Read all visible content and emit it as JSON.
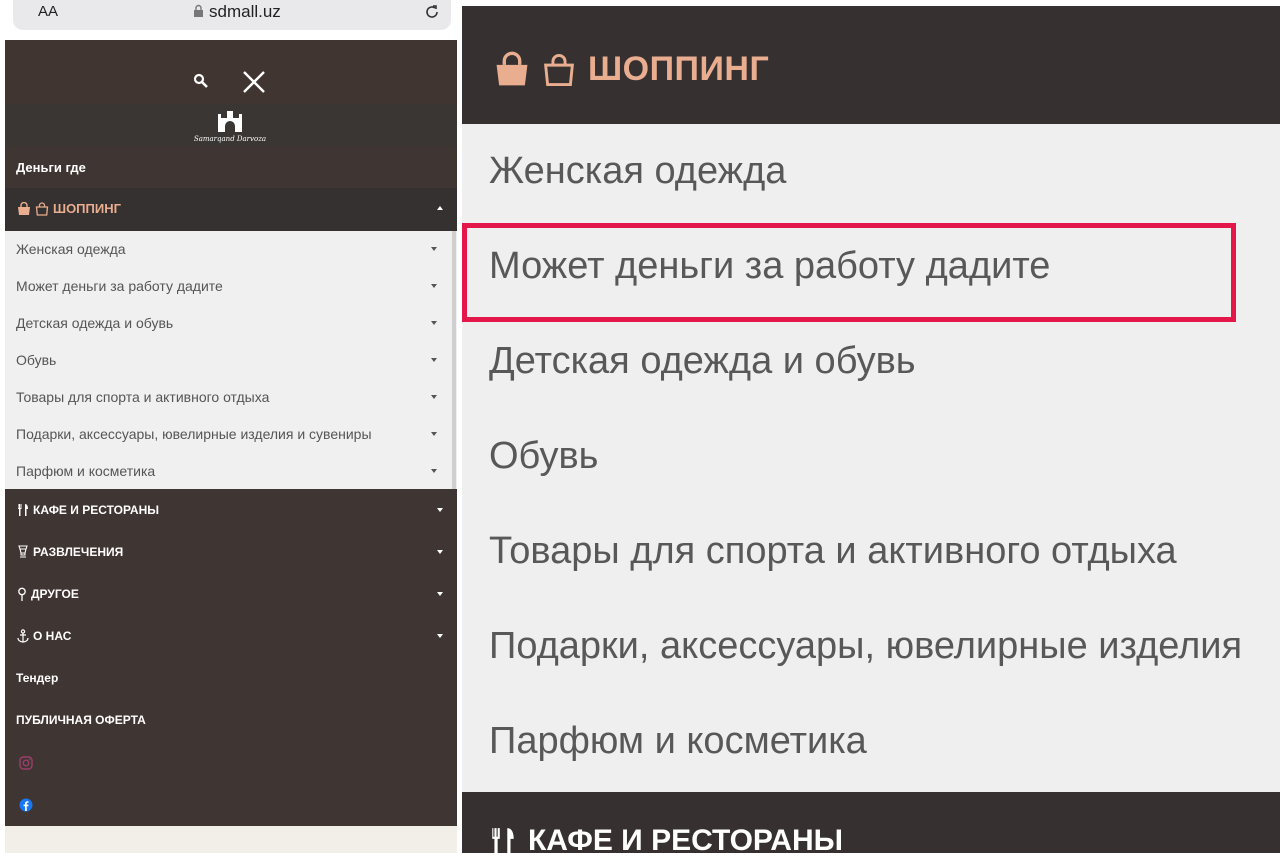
{
  "browser": {
    "text_size_label": "AA",
    "url": "sdmall.uz"
  },
  "logo_text": "Samarqand Darvoza",
  "menu": {
    "money_label": "Деньги где",
    "shopping_label": "ШОППИНГ",
    "shopping_items": [
      "Женская одежда",
      "Может деньги за работу дадите",
      "Детская одежда и обувь",
      "Обувь",
      "Товары для спорта и активного отдыха",
      "Подарки, аксессуары, ювелирные изделия и сувениры",
      "Парфюм и косметика"
    ],
    "cafes_label": "КАФЕ И РЕСТОРАНЫ",
    "entertainment_label": "РАЗВЛЕЧЕНИЯ",
    "other_label": "ДРУГОЕ",
    "about_label": "О НАС",
    "tender_label": "Тендер",
    "offer_label": "ПУБЛИЧНАЯ ОФЕРТА"
  },
  "zoom": {
    "shopping_label": "ШОППИНГ",
    "items": [
      "Женская одежда",
      "Может деньги за работу дадите",
      "Детская одежда и обувь",
      "Обувь",
      "Товары для спорта и активного отдыха",
      "Подарки, аксессуары, ювелирные изделия",
      "Парфюм и косметика"
    ],
    "cafes_label": "КАФЕ И РЕСТОРАНЫ"
  },
  "colors": {
    "accent_shopping": "#e9ad8f",
    "highlight_box": "#e4174a",
    "menu_dark": "#3f3532"
  }
}
